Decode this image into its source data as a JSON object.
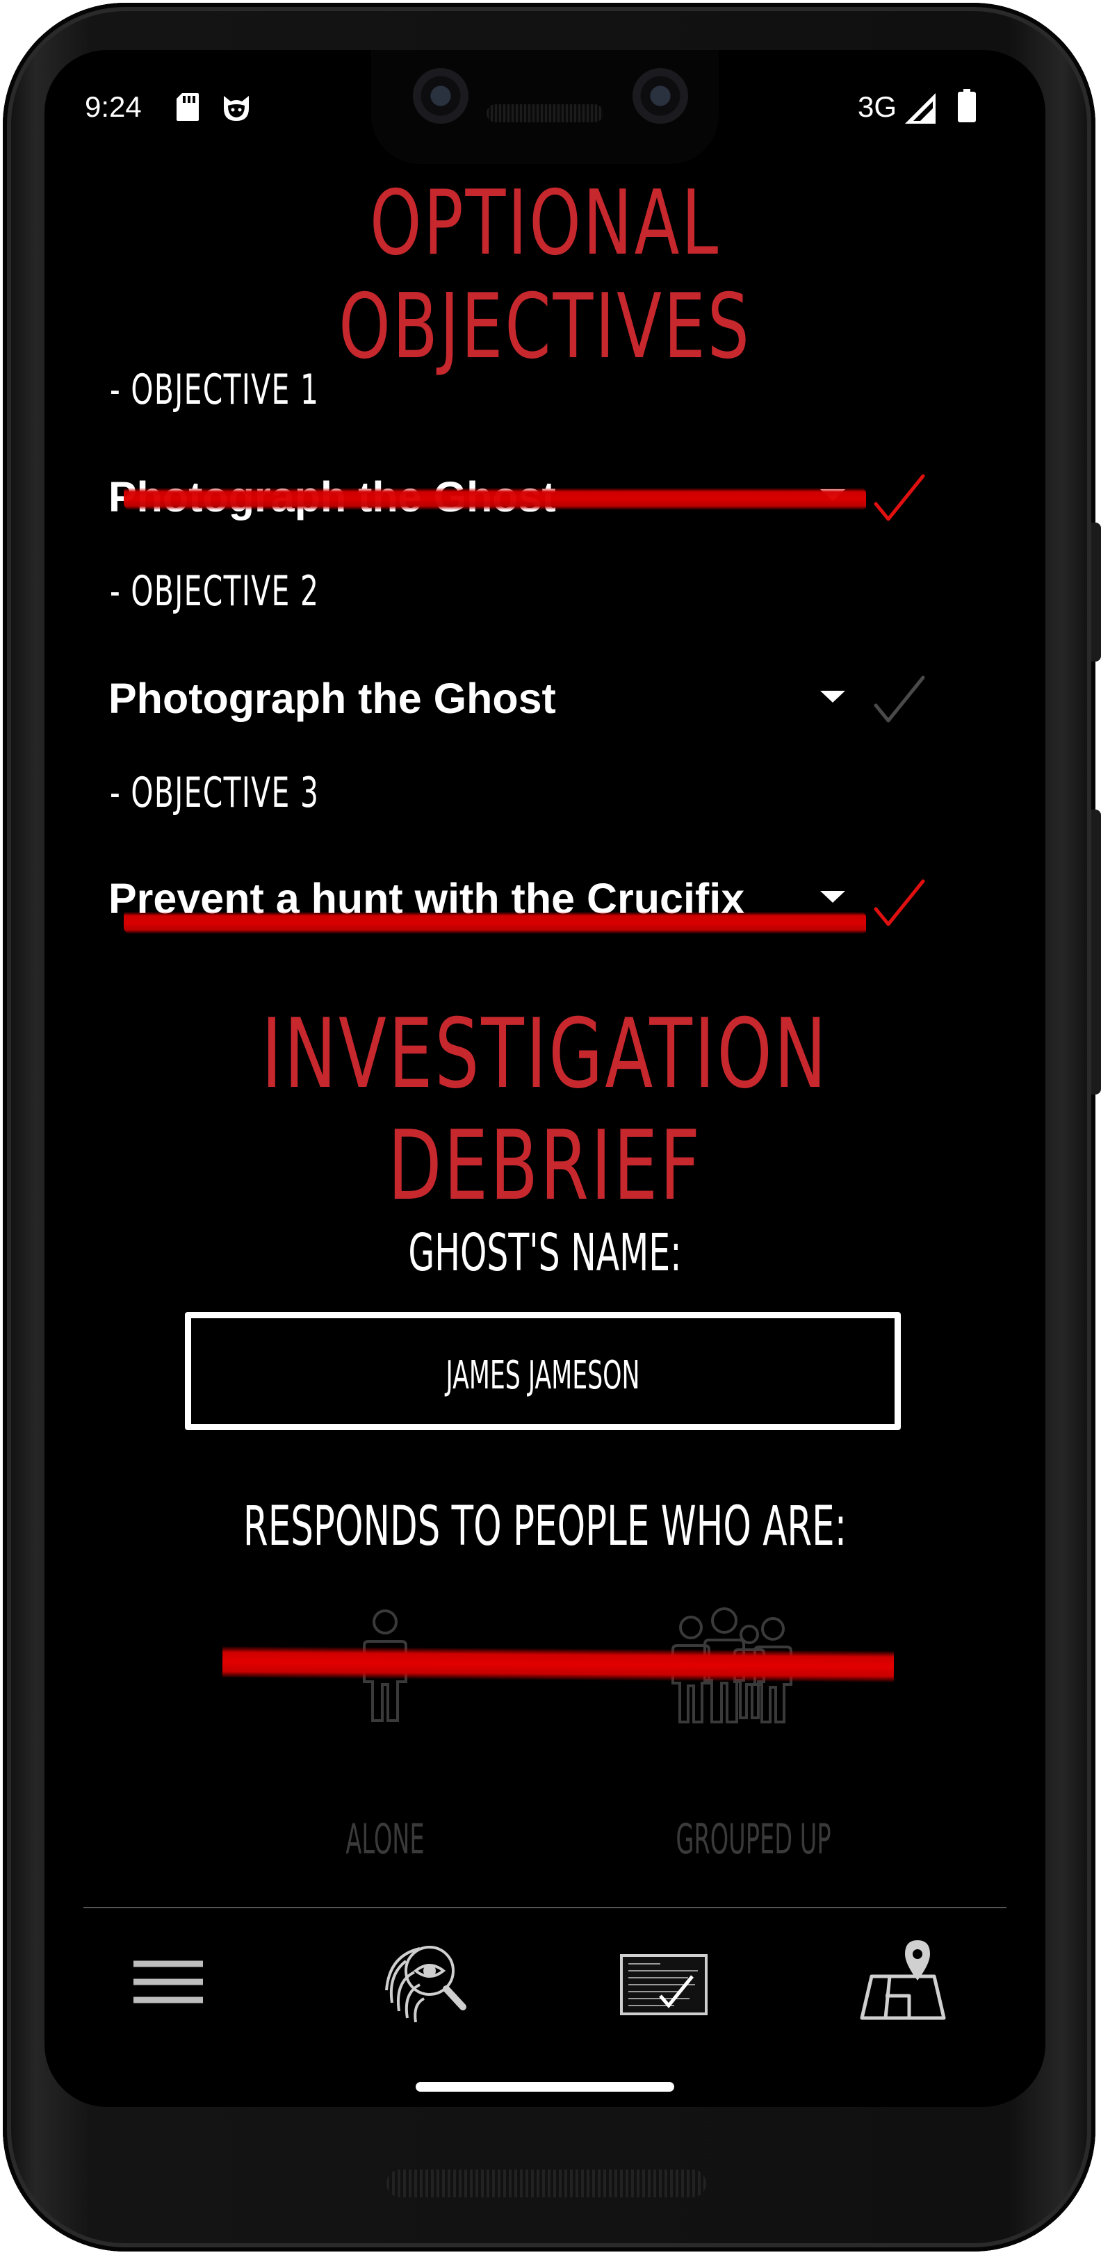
{
  "status_bar": {
    "time": "9:24",
    "network": "3G",
    "icons": [
      "sd-card-icon",
      "cat-face-icon",
      "signal-icon",
      "battery-icon"
    ]
  },
  "colors": {
    "accent_red": "#c7282e",
    "strike_red": "#e00000",
    "background": "#000000",
    "text": "#ffffff",
    "muted": "#3a3a3a"
  },
  "objectives": {
    "title": "OPTIONAL OBJECTIVES",
    "items": [
      {
        "label": "- OBJECTIVE 1",
        "value": "Photograph the Ghost",
        "completed": true
      },
      {
        "label": "- OBJECTIVE 2",
        "value": "Photograph the Ghost",
        "completed": false
      },
      {
        "label": "- OBJECTIVE 3",
        "value": "Prevent a hunt with the Crucifix",
        "completed": true
      }
    ]
  },
  "debrief": {
    "title": "INVESTIGATION DEBRIEF",
    "ghost_name_label": "GHOST'S NAME:",
    "ghost_name_value": "JAMES JAMESON",
    "responds_label": "RESPONDS TO PEOPLE WHO ARE:",
    "options": [
      {
        "label": "ALONE",
        "icon": "single-person-icon"
      },
      {
        "label": "GROUPED UP",
        "icon": "group-people-icon"
      }
    ],
    "responds_struck_out": true
  },
  "nav": {
    "items": [
      {
        "icon": "menu-icon"
      },
      {
        "icon": "fingerprint-search-icon"
      },
      {
        "icon": "objectives-board-icon"
      },
      {
        "icon": "map-pin-icon"
      }
    ]
  }
}
